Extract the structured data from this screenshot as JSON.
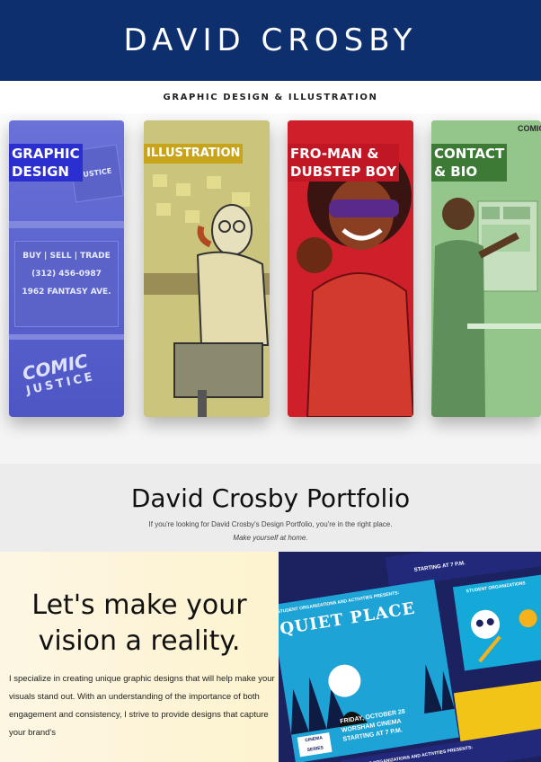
{
  "header": {
    "title": "DAVID CROSBY"
  },
  "tagline": "GRAPHIC DESIGN & ILLUSTRATION",
  "cards": [
    {
      "label_line1": "GRAPHIC",
      "label_line2": "DESIGN"
    },
    {
      "label_line1": "ILLUSTRATION",
      "label_line2": ""
    },
    {
      "label_line1": "FRO-MAN &",
      "label_line2": "DUBSTEP BOY"
    },
    {
      "label_line1": "CONTACT",
      "label_line2": "& BIO"
    }
  ],
  "card1_art": {
    "sign_top": "JUSTICE",
    "store_sign_line1": "BUY | SELL | TRADE",
    "store_sign_line2": "(312) 456-0987",
    "store_sign_line3": "1962 FANTASY AVE.",
    "logo_comic": "COMIC",
    "logo_justice": "JUSTICE"
  },
  "card4_art": {
    "poster_text": "COMIC"
  },
  "portfolio": {
    "title": "David Crosby Portfolio",
    "line1": "If you're looking for David Crosby's Design Portfolio, you're in the right place.",
    "line2": "Make yourself at home."
  },
  "intro": {
    "heading_line1": "Let's make your",
    "heading_line2": "vision a reality.",
    "body": "I specialize in creating unique graphic designs that will help make your visuals stand out. With an understanding of the importance of both engagement and consistency, I strive to provide designs that capture your brand's"
  },
  "poster": {
    "small_header": "STUDENT ORGANIZATIONS AND ACTIVITIES PRESENTS:",
    "title": "QUIET PLACE",
    "date_line1": "FRIDAY, OCTOBER 28",
    "date_line2": "WORSHAM CINEMA",
    "date_line3": "STARTING AT 7 P.M.",
    "top_strip": "STARTING AT 7 P.M.",
    "side_label": "STUDENT ORGANIZATIONS",
    "cinema_badge": "CINEMA SERIES",
    "bottom_strip": "STUDENT ORGANIZATIONS AND ACTIVITIES PRESENTS:"
  },
  "colors": {
    "header_bg": "#0e2f6e",
    "card1": "#4d56c4",
    "card2": "#c9c27a",
    "card3": "#cf1f2b",
    "card4": "#8cc084",
    "poster_bg": "#1c2160"
  }
}
